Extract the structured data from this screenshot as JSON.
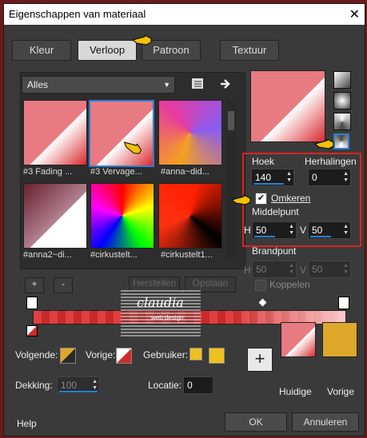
{
  "window": {
    "title": "Eigenschappen van materiaal",
    "close": "✕"
  },
  "tabs": [
    {
      "label": "Kleur"
    },
    {
      "label": "Verloop"
    },
    {
      "label": "Patroon"
    },
    {
      "label": "Textuur"
    }
  ],
  "category": {
    "value": "Alles"
  },
  "thumbs": [
    {
      "label": "#3 Fading ..."
    },
    {
      "label": "#3 Vervage..."
    },
    {
      "label": "#anna~did..."
    },
    {
      "label": "#anna2~di..."
    },
    {
      "label": "#cirkustelt..."
    },
    {
      "label": "#cirkustelt1..."
    }
  ],
  "buttons": {
    "add": "+",
    "remove": "-",
    "reset": "Herstellen",
    "save": "Opslaan",
    "plus": "+",
    "ok": "OK",
    "cancel": "Annuleren",
    "help": "Help"
  },
  "angle": {
    "label": "Hoek",
    "value": "140"
  },
  "repeats": {
    "label": "Herhalingen",
    "value": "0"
  },
  "invert": {
    "label": "Omkeren",
    "checked": true
  },
  "center": {
    "label": "Middelpunt",
    "h_label": "H",
    "h": "50",
    "v_label": "V",
    "v": "50"
  },
  "focal": {
    "label": "Brandpunt",
    "h_label": "H",
    "h": "50",
    "v_label": "V",
    "v": "50"
  },
  "link": {
    "label": "Koppelen"
  },
  "bottom": {
    "next": "Volgende:",
    "prev": "Vorige:",
    "user": "Gebruiker:",
    "opacity_label": "Dekking:",
    "opacity": "100",
    "location_label": "Locatie:",
    "location": "0",
    "current": "Huidige",
    "previous": "Vorige"
  },
  "watermark": {
    "name": "claudia",
    "sub": "web design"
  },
  "colors": {
    "accent": "#2a7fd4",
    "red": "#d32a2a",
    "gold": "#e0a82a",
    "frame": "#d22222"
  }
}
